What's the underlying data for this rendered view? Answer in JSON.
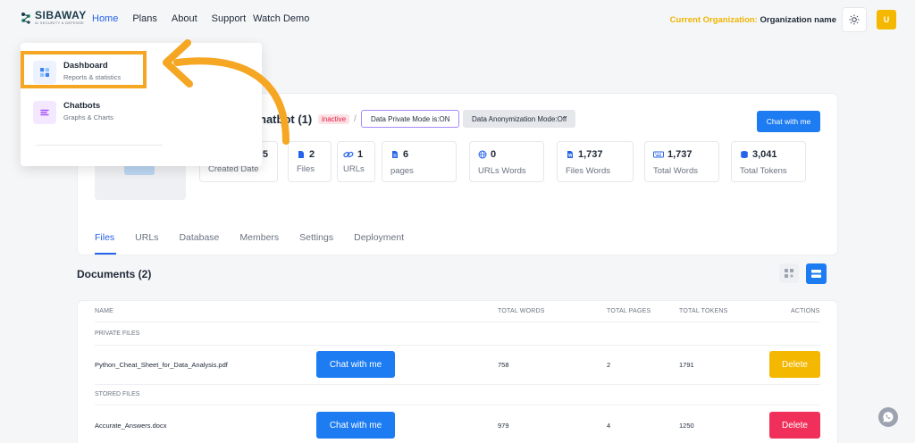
{
  "brand": {
    "name": "SIBAWAY",
    "tagline": "AI SECURITY & DEFENSE"
  },
  "nav": {
    "items": [
      {
        "label": "Home",
        "active": true
      },
      {
        "label": "Plans"
      },
      {
        "label": "About"
      },
      {
        "label": "Support"
      },
      {
        "label": "Watch Demo"
      }
    ]
  },
  "org": {
    "label": "Current Organization:",
    "name": "Organization name"
  },
  "user": {
    "initial": "U"
  },
  "chatbot": {
    "title": "hatbot (1)",
    "status": "inactive",
    "privacy": "Data Private Mode is:ON",
    "anonymization": "Data Anonymization Mode:Off",
    "chat_label": "Chat with me"
  },
  "stats": [
    {
      "value": "5",
      "label": "Created Date",
      "icon": "calendar-icon"
    },
    {
      "value": "2",
      "label": "Files",
      "icon": "file-icon"
    },
    {
      "value": "1",
      "label": "URLs",
      "icon": "link-icon"
    },
    {
      "value": "6",
      "label": "pages",
      "icon": "page-icon"
    },
    {
      "value": "0",
      "label": "URLs Words",
      "icon": "globe-icon"
    },
    {
      "value": "1,737",
      "label": "Files Words",
      "icon": "word-file-icon"
    },
    {
      "value": "1,737",
      "label": "Total Words",
      "icon": "keyboard-icon"
    },
    {
      "value": "3,041",
      "label": "Total Tokens",
      "icon": "database-icon"
    }
  ],
  "tabs": [
    {
      "label": "Files",
      "active": true
    },
    {
      "label": "URLs"
    },
    {
      "label": "Database"
    },
    {
      "label": "Members"
    },
    {
      "label": "Settings"
    },
    {
      "label": "Deployment"
    }
  ],
  "documents": {
    "title": "Documents (2)",
    "columns": {
      "name": "NAME",
      "words": "TOTAL WORDS",
      "pages": "TOTAL PAGES",
      "tokens": "TOTAL TOKENS",
      "actions": "ACTIONS"
    },
    "sections": [
      {
        "label": "PRIVATE FILES",
        "rows": [
          {
            "name": "Python_Cheat_Sheet_for_Data_Analysis.pdf",
            "chat": "Chat with me",
            "words": "758",
            "pages": "2",
            "tokens": "1791",
            "action": "Delete",
            "action_color": "#f5b800"
          }
        ]
      },
      {
        "label": "STORED FILES",
        "rows": [
          {
            "name": "Accurate_Answers.docx",
            "chat": "Chat with me",
            "words": "979",
            "pages": "4",
            "tokens": "1250",
            "action": "Delete",
            "action_color": "#f0305a"
          }
        ]
      }
    ]
  },
  "dropdown": {
    "items": [
      {
        "title": "Dashboard",
        "subtitle": "Reports & statistics",
        "icon": "dashboard-icon"
      },
      {
        "title": "Chatbots",
        "subtitle": "Graphs & Charts",
        "icon": "chatbot-icon"
      }
    ]
  },
  "colors": {
    "primary": "#1d7cf2",
    "accent": "#f5a623",
    "warning": "#f5b800",
    "danger": "#f0305a"
  }
}
